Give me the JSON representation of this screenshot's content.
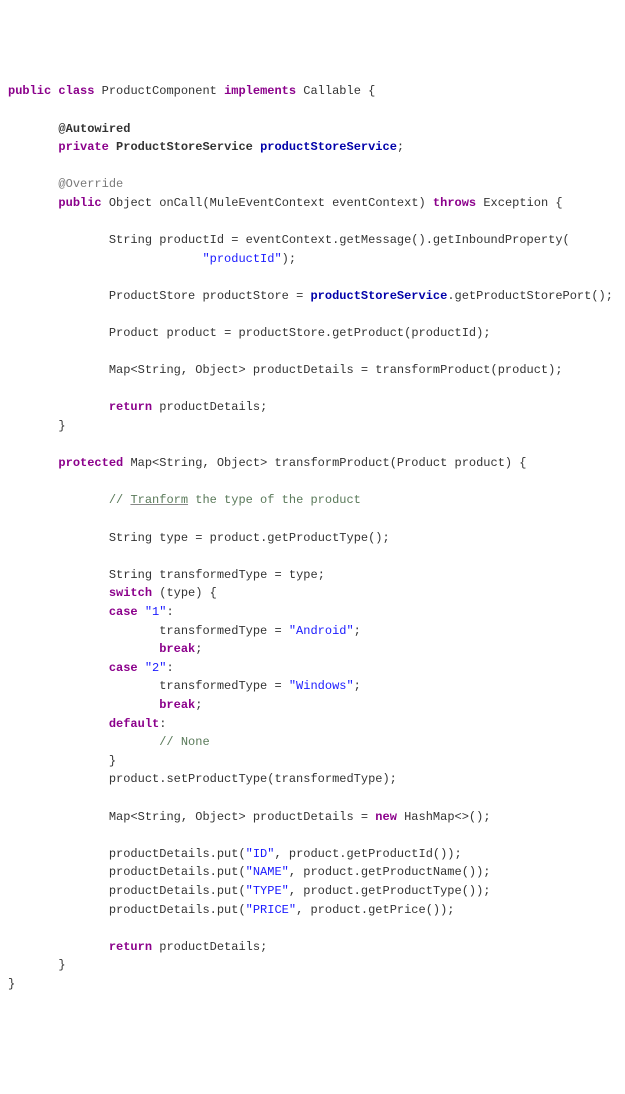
{
  "t": {
    "kw_public": "public",
    "kw_class": "class",
    "kw_implements": "implements",
    "kw_private": "private",
    "kw_throws": "throws",
    "kw_return": "return",
    "kw_protected": "protected",
    "kw_switch": "switch",
    "kw_case": "case",
    "kw_break": "break",
    "kw_default": "default",
    "kw_new": "new",
    "ann_autowired": "@Autowired",
    "ann_override": "@Override",
    "cls_product_component": "ProductComponent",
    "cls_callable": "Callable",
    "cls_product_store_service": "ProductStoreService",
    "fld_product_store_service": "productStoreService",
    "type_object": "Object",
    "type_string": "String",
    "type_mule_event_context": "MuleEventContext",
    "type_exception": "Exception",
    "type_product_store": "ProductStore",
    "type_product": "Product",
    "type_map": "Map",
    "type_hashmap": "HashMap",
    "mtd_oncall": "onCall",
    "mtd_transform": "transformProduct",
    "var_eventcontext": "eventContext",
    "var_productid": "productId",
    "var_productstore": "productStore",
    "var_product": "product",
    "var_productdetails": "productDetails",
    "var_type": "type",
    "var_transformedtype": "transformedType",
    "call_getmessage": ".getMessage().getInboundProperty(",
    "call_getport": ".getProductStorePort();",
    "call_getproduct": ".getProduct(productId);",
    "call_setproducttype": "product.setProductType(transformedType);",
    "call_getproducttype": "product.getProductType();",
    "call_put_id": "productDetails.put(",
    "call_getproductid": ", product.getProductId());",
    "call_getproductname": ", product.getProductName());",
    "call_getproducttype2": ", product.getProductType());",
    "call_getprice": ", product.getPrice());",
    "str_productid": "\"productId\"",
    "str_1": "\"1\"",
    "str_2": "\"2\"",
    "str_android": "\"Android\"",
    "str_windows": "\"Windows\"",
    "str_id": "\"ID\"",
    "str_name": "\"NAME\"",
    "str_type": "\"TYPE\"",
    "str_price": "\"PRICE\"",
    "com_tranform": "// ",
    "com_tranform_word": "Tranform",
    "com_tranform_rest": " the type of the product",
    "com_none": "// None",
    "eq": " = ",
    "assign_transform": " = transformProduct(product);",
    "eq_type": " = type;",
    "eq_android_pre": "transformedType = ",
    "typeparam_sobj": "<String, Object>",
    "diamond": "<>();",
    "lb": " {",
    "cb": "}",
    "semi": ";",
    "colon": ":",
    "close_paren_semi": ");",
    "space_open": " (",
    "close_paren_brace": ") {",
    "args_oncall": "(MuleEventContext eventContext) ",
    "args_transform": "(Product product) {"
  }
}
